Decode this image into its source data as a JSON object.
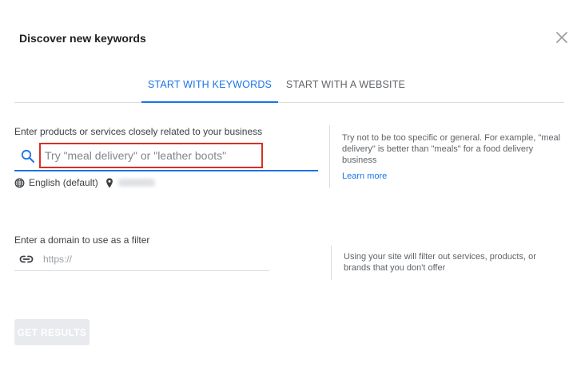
{
  "dialog": {
    "title": "Discover new keywords"
  },
  "tabs": [
    {
      "label": "START WITH KEYWORDS",
      "active": true
    },
    {
      "label": "START WITH A WEBSITE",
      "active": false
    }
  ],
  "keywords_section": {
    "label": "Enter products or services closely related to your business",
    "input_value": "",
    "input_placeholder": "Try \"meal delivery\" or \"leather boots\"",
    "language": "English (default)",
    "location": "",
    "help_text": "Try not to be too specific or general. For example, \"meal delivery\" is better than \"meals\" for a food delivery business",
    "learn_more": "Learn more"
  },
  "domain_section": {
    "label": "Enter a domain to use as a filter",
    "input_value": "",
    "input_placeholder": "https://",
    "help_text": "Using your site will filter out services, products, or brands that you don't offer"
  },
  "actions": {
    "get_results": "GET RESULTS",
    "get_results_enabled": false
  },
  "icons": {
    "close": "close-icon",
    "search": "search-icon",
    "language": "globe-icon",
    "location": "location-pin-icon",
    "domain": "link-icon"
  },
  "colors": {
    "accent": "#1a73e8",
    "highlight_box": "#d93025",
    "disabled_button": "#e8eaed"
  }
}
